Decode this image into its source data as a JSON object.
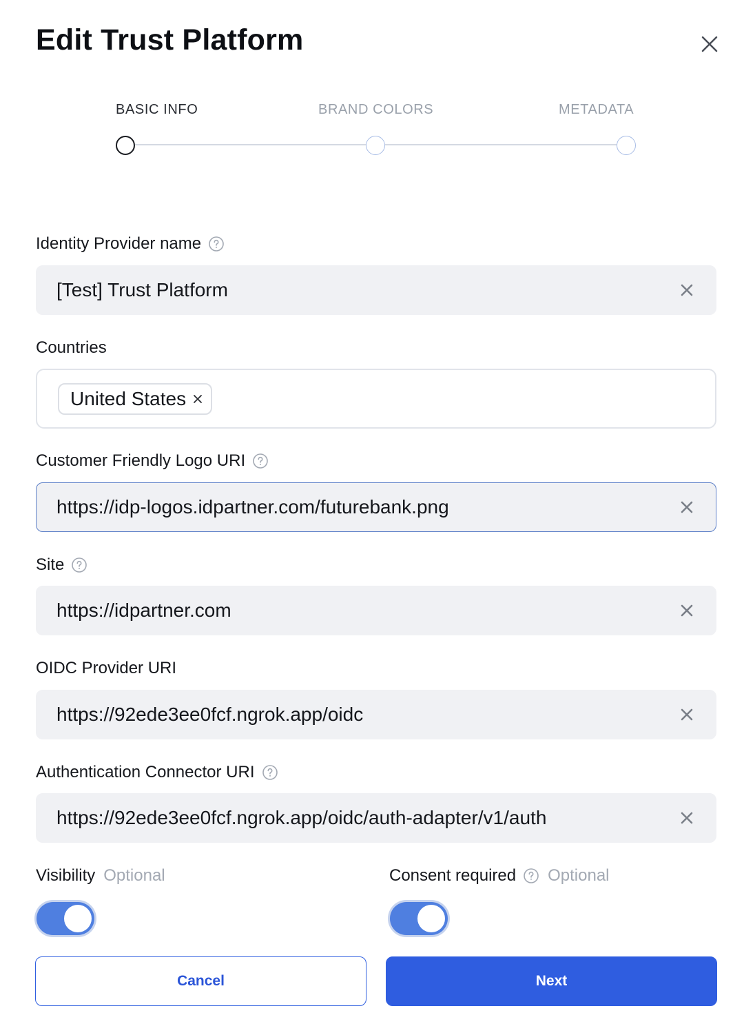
{
  "dialog": {
    "title": "Edit Trust Platform",
    "close_icon": "close-icon"
  },
  "stepper": {
    "steps": [
      {
        "label": "BASIC INFO",
        "state": "active"
      },
      {
        "label": "BRAND COLORS",
        "state": "inactive"
      },
      {
        "label": "METADATA",
        "state": "inactive"
      }
    ]
  },
  "fields": {
    "idp_name": {
      "label": "Identity Provider name",
      "value": "[Test] Trust Platform",
      "has_help": true
    },
    "countries": {
      "label": "Countries",
      "selected": [
        "United States"
      ]
    },
    "logo_uri": {
      "label": "Customer Friendly Logo URI",
      "value": "https://idp-logos.idpartner.com/futurebank.png",
      "has_help": true,
      "focused": true
    },
    "site": {
      "label": "Site",
      "value": "https://idpartner.com",
      "has_help": true
    },
    "oidc_uri": {
      "label": "OIDC Provider URI",
      "value": "https://92ede3ee0fcf.ngrok.app/oidc"
    },
    "auth_connector_uri": {
      "label": "Authentication Connector URI",
      "value": "https://92ede3ee0fcf.ngrok.app/oidc/auth-adapter/v1/auth",
      "has_help": true
    }
  },
  "toggles": {
    "visibility": {
      "label": "Visibility",
      "optional": "Optional",
      "on": true
    },
    "consent": {
      "label": "Consent required",
      "optional": "Optional",
      "on": true
    }
  },
  "actions": {
    "cancel_label": "Cancel",
    "next_label": "Next"
  },
  "colors": {
    "primary": "#2f5de0",
    "toggle_on": "#4f7fe0",
    "input_bg": "#f0f1f4"
  }
}
